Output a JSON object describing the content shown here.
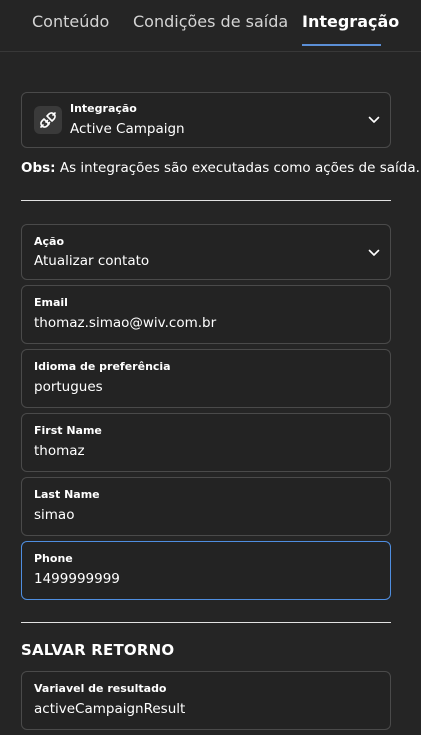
{
  "tabs": [
    {
      "label": "Conteúdo",
      "active": false
    },
    {
      "label": "Condições de saída",
      "active": false
    },
    {
      "label": "Integração",
      "active": true
    }
  ],
  "integration": {
    "label": "Integração",
    "value": "Active Campaign",
    "icon": "plug-icon"
  },
  "obs": {
    "prefix": "Obs:",
    "text": " As integrações são executadas como ações de saída."
  },
  "action": {
    "label": "Ação",
    "value": "Atualizar contato"
  },
  "fields": [
    {
      "label": "Email",
      "value": "thomaz.simao@wiv.com.br"
    },
    {
      "label": "Idioma de preferência",
      "value": "portugues"
    },
    {
      "label": "First Name",
      "value": "thomaz"
    },
    {
      "label": "Last Name",
      "value": "simao"
    },
    {
      "label": "Phone",
      "value": "1499999999"
    }
  ],
  "save_return": {
    "title": "SALVAR RETORNO",
    "field_label": "Variavel de resultado",
    "field_value": "activeCampaignResult"
  },
  "colors": {
    "background": "#252525",
    "accent": "#4f8ee0",
    "border": "#4a4a4a"
  }
}
